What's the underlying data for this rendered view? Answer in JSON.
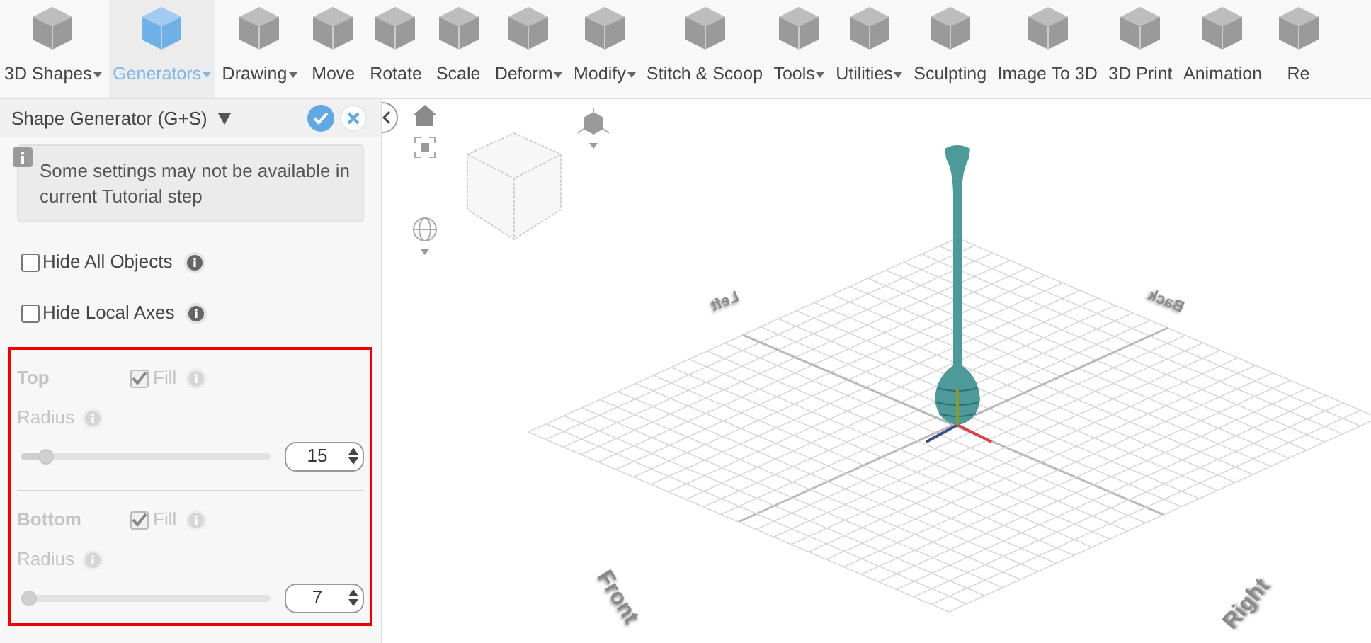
{
  "toolbar": {
    "items": [
      {
        "label": "3D Shapes",
        "dropdown": true,
        "selected": false
      },
      {
        "label": "Generators",
        "dropdown": true,
        "selected": true
      },
      {
        "label": "Drawing",
        "dropdown": true,
        "selected": false
      },
      {
        "label": "Move",
        "dropdown": false,
        "selected": false
      },
      {
        "label": "Rotate",
        "dropdown": false,
        "selected": false
      },
      {
        "label": "Scale",
        "dropdown": false,
        "selected": false
      },
      {
        "label": "Deform",
        "dropdown": true,
        "selected": false
      },
      {
        "label": "Modify",
        "dropdown": true,
        "selected": false
      },
      {
        "label": "Stitch & Scoop",
        "dropdown": false,
        "selected": false
      },
      {
        "label": "Tools",
        "dropdown": true,
        "selected": false
      },
      {
        "label": "Utilities",
        "dropdown": true,
        "selected": false
      },
      {
        "label": "Sculpting",
        "dropdown": false,
        "selected": false
      },
      {
        "label": "Image To 3D",
        "dropdown": false,
        "selected": false
      },
      {
        "label": "3D Print",
        "dropdown": false,
        "selected": false
      },
      {
        "label": "Animation",
        "dropdown": false,
        "selected": false
      },
      {
        "label": "Re",
        "dropdown": false,
        "selected": false
      }
    ]
  },
  "panel": {
    "title": "Shape Generator (G+S)",
    "notice": "Some settings may not be available in current Tutorial step",
    "options": [
      {
        "label": "Hide All Objects",
        "checked": false
      },
      {
        "label": "Hide Local Axes",
        "checked": false
      }
    ],
    "sections": [
      {
        "title": "Top",
        "fill_label": "Fill",
        "fill_checked": true,
        "radius_label": "Radius",
        "level": 0.07,
        "value": "15",
        "disabled": true
      },
      {
        "title": "Bottom",
        "fill_label": "Fill",
        "fill_checked": true,
        "radius_label": "Radius",
        "level": 0.0,
        "value": "7",
        "disabled": true
      }
    ]
  },
  "viewport": {
    "axis_labels": [
      {
        "text": "Left",
        "kind": "back"
      },
      {
        "text": "Back",
        "kind": "back"
      },
      {
        "text": "Front",
        "kind": "front"
      },
      {
        "text": "Right",
        "kind": "front"
      }
    ]
  }
}
